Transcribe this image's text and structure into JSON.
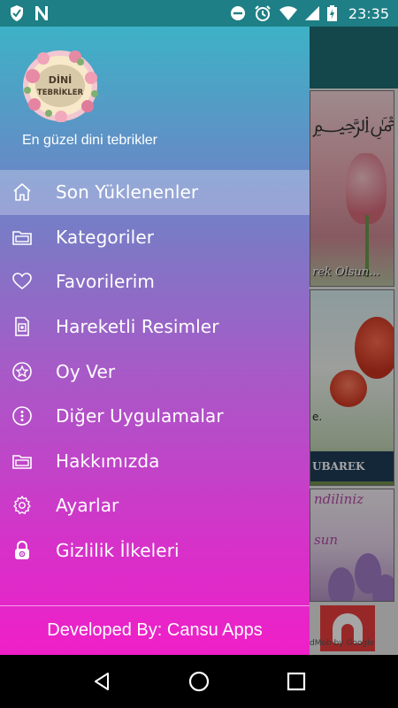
{
  "status_bar": {
    "time": "23:35",
    "left_icons": [
      "shield-icon",
      "n-letter-icon"
    ],
    "right_icons": [
      "do-not-disturb-icon",
      "alarm-icon",
      "wifi-icon",
      "signal-icon",
      "battery-charging-icon"
    ]
  },
  "drawer": {
    "logo_text_line1": "DİNİ",
    "logo_text_line2": "TEBRİKLER",
    "subtitle": "En güzel dini tebrikler",
    "menu": [
      {
        "label": "Son Yüklenenler",
        "icon": "home-icon",
        "active": true
      },
      {
        "label": "Kategoriler",
        "icon": "folder-icon",
        "active": false
      },
      {
        "label": "Favorilerim",
        "icon": "heart-icon",
        "active": false
      },
      {
        "label": "Hareketli Resimler",
        "icon": "animated-image-icon",
        "active": false
      },
      {
        "label": "Oy Ver",
        "icon": "star-icon",
        "active": false
      },
      {
        "label": "Diğer Uygulamalar",
        "icon": "more-vertical-icon",
        "active": false
      },
      {
        "label": "Hakkımızda",
        "icon": "folder-icon",
        "active": false
      },
      {
        "label": "Ayarlar",
        "icon": "settings-icon",
        "active": false
      },
      {
        "label": "Gizlilik İlkeleri",
        "icon": "lock-icon",
        "active": false
      }
    ],
    "footer": "Developed By: Cansu Apps"
  },
  "background": {
    "card1_caption": "rek Olsun...",
    "card2_caption": "UBAREK OLSUN!",
    "card2_edge_text": "e.",
    "card3_text1": "ndiliniz",
    "card3_text2": "sun",
    "ad_text": "dMob by Google"
  },
  "colors": {
    "accent_teal": "#1f7f86",
    "drawer_top": "#3db2c6",
    "drawer_bottom": "#ef1fc8"
  }
}
